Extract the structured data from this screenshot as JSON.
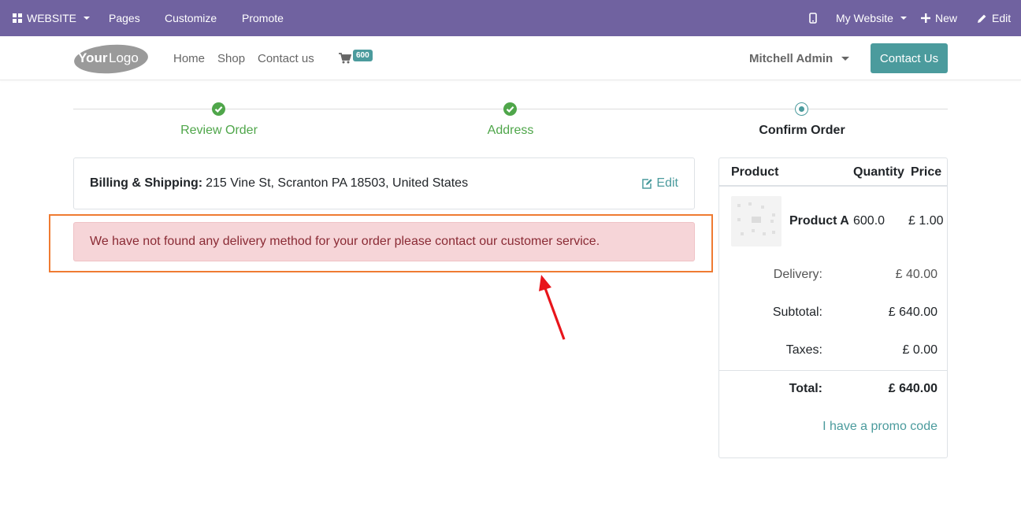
{
  "adminbar": {
    "website_label": "WEBSITE",
    "pages_label": "Pages",
    "customize_label": "Customize",
    "promote_label": "Promote",
    "my_website_label": "My Website",
    "new_label": "New",
    "edit_label": "Edit",
    "bg_color": "#7062a0"
  },
  "header": {
    "logo_text": "YourLogo",
    "nav": [
      "Home",
      "Shop",
      "Contact us"
    ],
    "cart_count": "600",
    "user_name": "Mitchell Admin",
    "contact_button": "Contact Us",
    "accent_color": "#4b9b9d"
  },
  "wizard": {
    "steps": [
      {
        "label": "Review Order",
        "state": "done"
      },
      {
        "label": "Address",
        "state": "done"
      },
      {
        "label": "Confirm Order",
        "state": "current"
      }
    ]
  },
  "billing": {
    "label": "Billing & Shipping:",
    "address": "215 Vine St, Scranton PA 18503, United States",
    "edit_label": "Edit"
  },
  "alert": {
    "message": "We have not found any delivery method for your order please contact our customer service."
  },
  "summary": {
    "headers": {
      "product": "Product",
      "quantity": "Quantity",
      "price": "Price"
    },
    "items": [
      {
        "name": "Product A",
        "quantity": "600.0",
        "price": "£ 1.00"
      }
    ],
    "delivery_label": "Delivery:",
    "delivery_value": "£ 40.00",
    "subtotal_label": "Subtotal:",
    "subtotal_value": "£ 640.00",
    "taxes_label": "Taxes:",
    "taxes_value": "£ 0.00",
    "total_label": "Total:",
    "total_value": "£ 640.00",
    "promo_label": "I have a promo code"
  }
}
